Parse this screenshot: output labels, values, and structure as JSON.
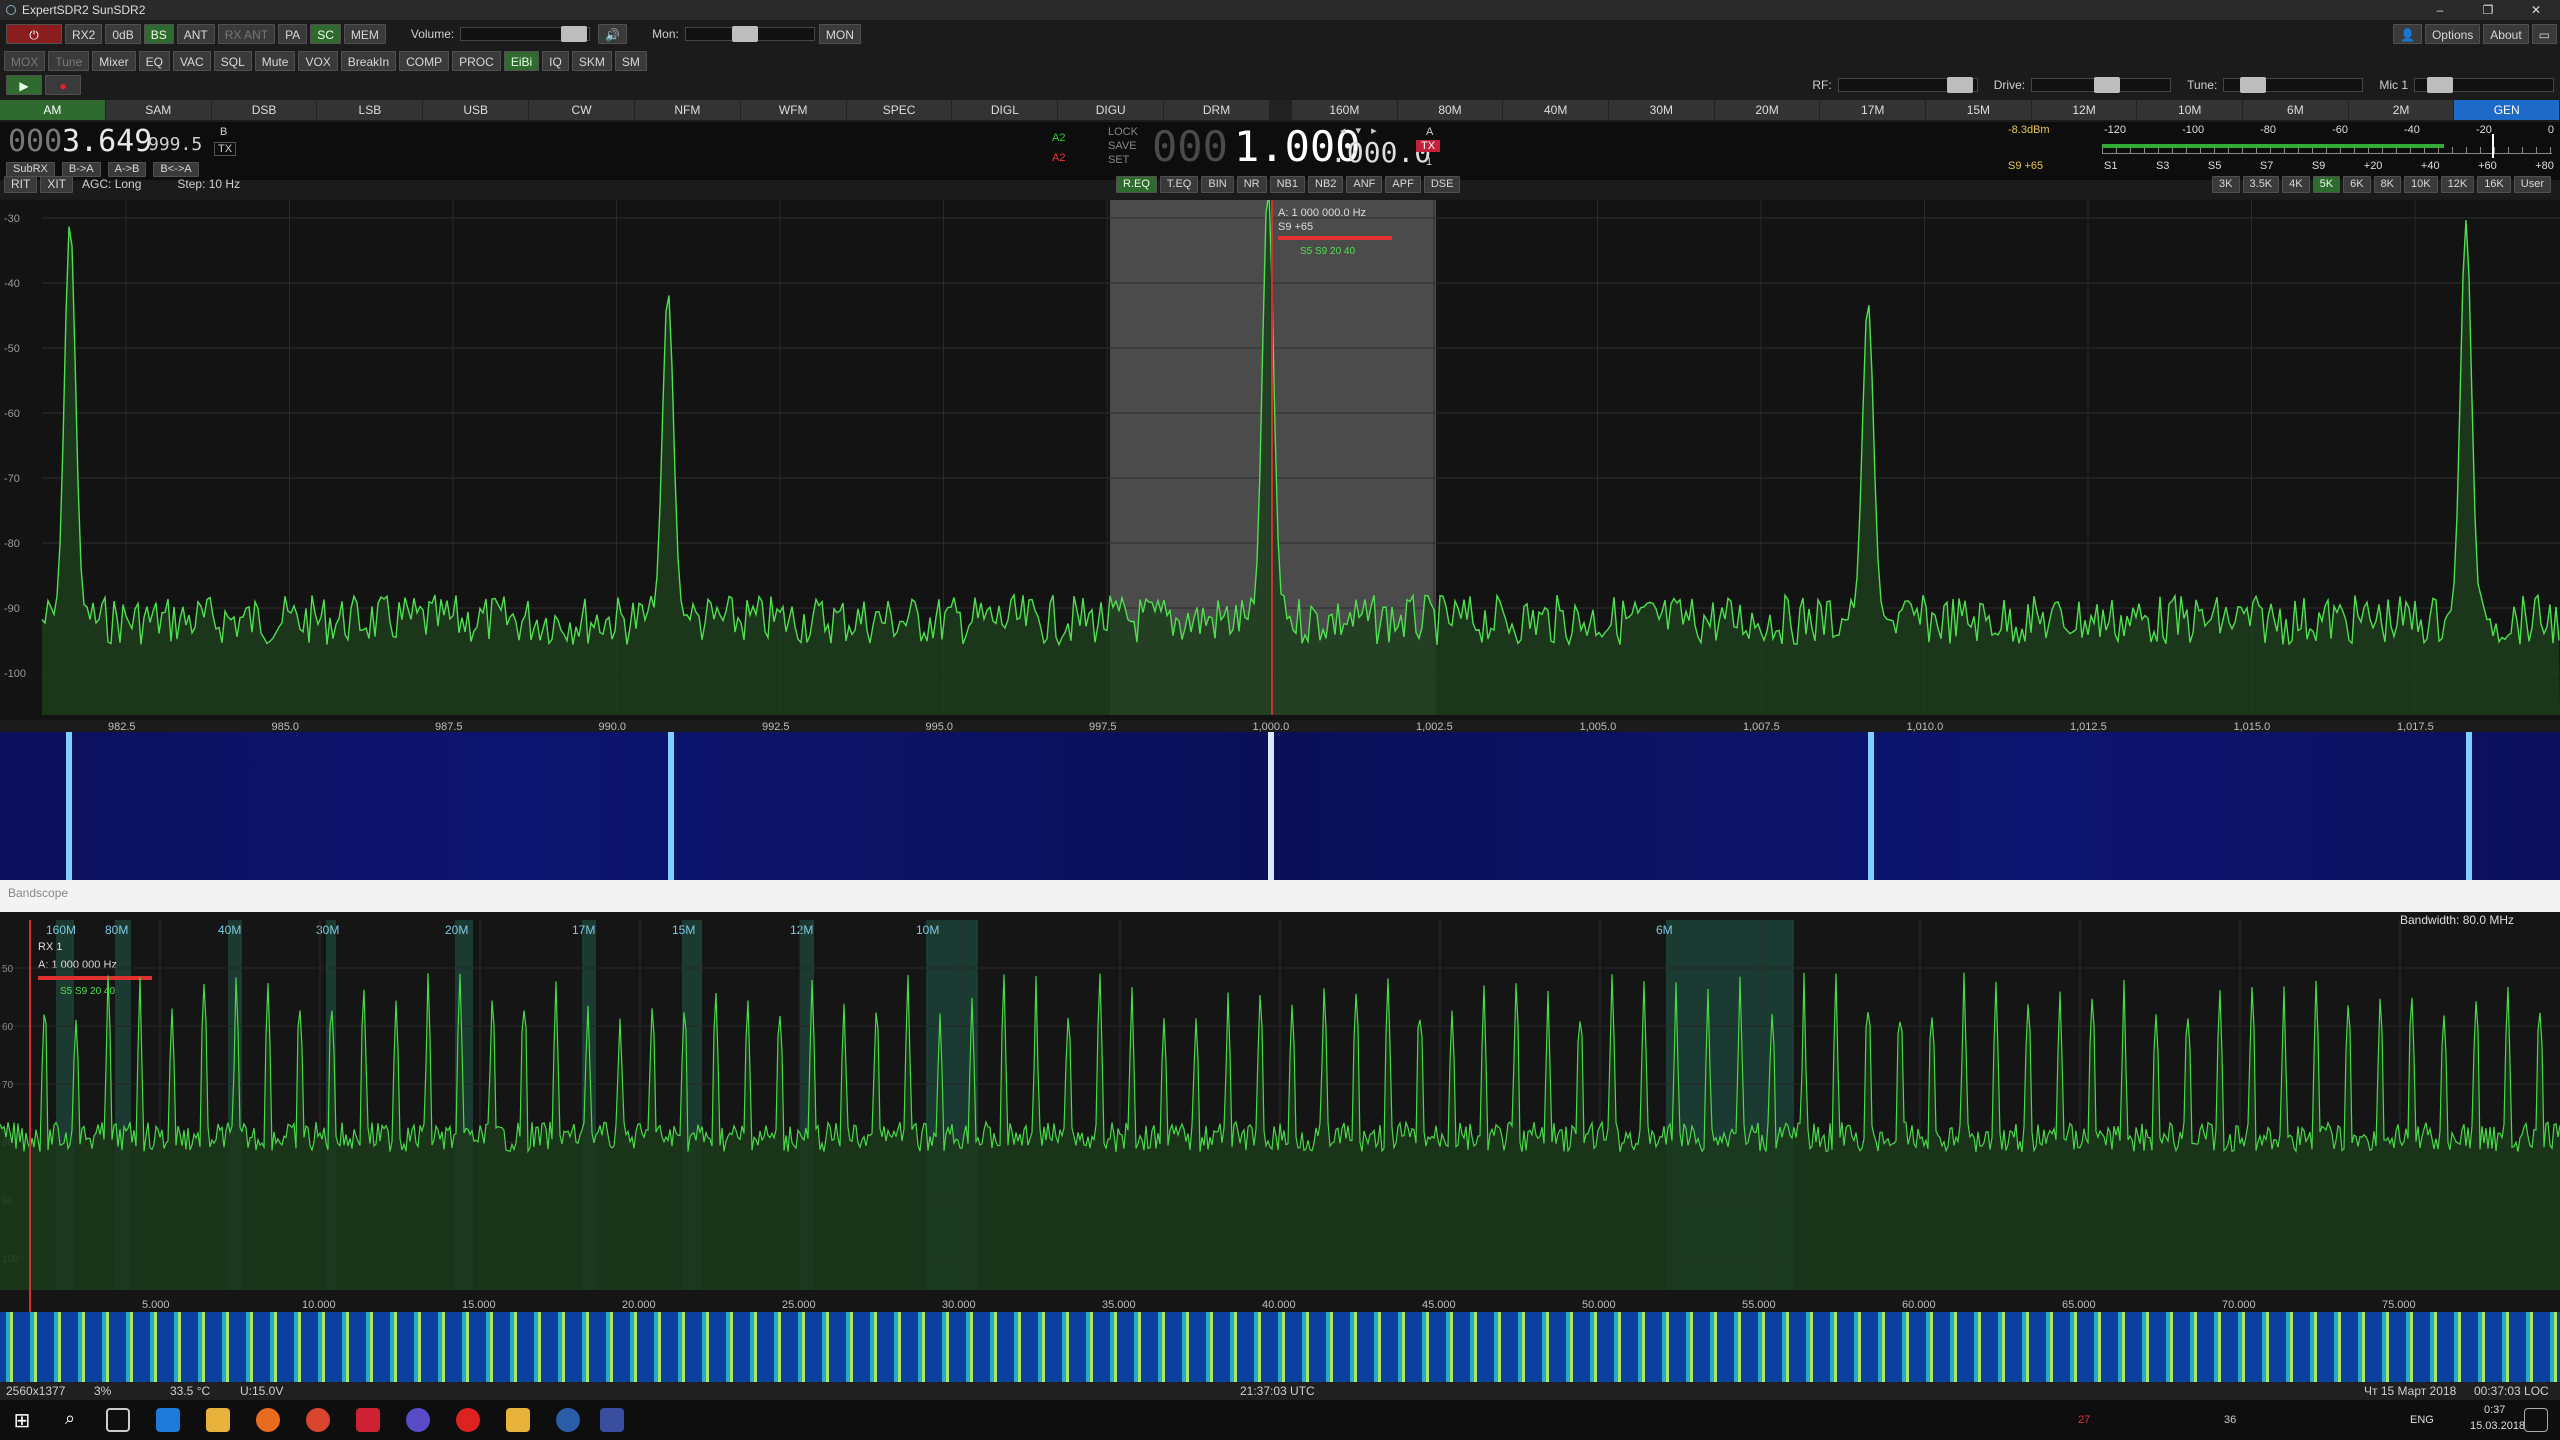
{
  "window": {
    "title": "ExpertSDR2 SunSDR2",
    "minimize": "–",
    "maximize": "❐",
    "close": "✕"
  },
  "toolbar1": {
    "power_icon": "power-icon",
    "rx2": "RX2",
    "att": "0dB",
    "bs": "BS",
    "ant": "ANT",
    "rxant": "RX ANT",
    "pa": "PA",
    "sc": "SC",
    "mem": "MEM",
    "volume_label": "Volume:",
    "mon_label": "Mon:",
    "mon_btn": "MON",
    "options": "Options",
    "about": "About"
  },
  "toolbar2": {
    "items": [
      "MOX",
      "Tune",
      "Mixer",
      "EQ",
      "VAC",
      "SQL",
      "Mute",
      "VOX",
      "BreakIn",
      "COMP",
      "PROC",
      "EiBi",
      "IQ",
      "SKM",
      "SM"
    ]
  },
  "toolbar3": {
    "rf_label": "RF:",
    "drive_label": "Drive:",
    "tune_label": "Tune:",
    "mic_label": "Mic 1"
  },
  "modes": [
    "AM",
    "SAM",
    "DSB",
    "LSB",
    "USB",
    "CW",
    "NFM",
    "WFM",
    "SPEC",
    "DIGL",
    "DIGU",
    "DRM"
  ],
  "bands": [
    "160M",
    "80M",
    "40M",
    "30M",
    "20M",
    "17M",
    "15M",
    "12M",
    "10M",
    "6M",
    "2M",
    "GEN"
  ],
  "vfo_b": {
    "freq_dim": "000",
    "freq_main": "3.649",
    "freq_sub": "999.5",
    "label": "B",
    "tx": "TX",
    "subrx": "SubRX",
    "ab": "B->A",
    "atob": "A->B",
    "swap": "B<->A"
  },
  "vfo_a": {
    "a2": "A2",
    "a2b": "A2",
    "lock": "LOCK",
    "save": "SAVE",
    "set": "SET",
    "freq_dim": "000",
    "freq_main": "1.000",
    "freq_sub": ".000.0",
    "label": "A",
    "tx": "TX",
    "num": "1"
  },
  "smeter": {
    "dbm": "-8.3dBm",
    "reading": "S9 +65",
    "scale_top": [
      "-120",
      "-100",
      "-80",
      "-60",
      "-40",
      "-20",
      "0"
    ],
    "scale_bottom": [
      "S1",
      "S3",
      "S5",
      "S7",
      "S9",
      "+20",
      "+40",
      "+60",
      "+80"
    ]
  },
  "controls_row": {
    "rit": "RIT",
    "xit": "XIT",
    "agc": "AGC: Long",
    "step": "Step: 10 Hz",
    "dsp": [
      "R.EQ",
      "T.EQ",
      "BIN",
      "NR",
      "NB1",
      "NB2",
      "ANF",
      "APF",
      "DSE"
    ],
    "bw": [
      "3K",
      "3.5K",
      "4K",
      "5K",
      "6K",
      "8K",
      "10K",
      "12K",
      "16K",
      "User"
    ]
  },
  "spectrum": {
    "y_ticks": [
      "-30",
      "-40",
      "-50",
      "-60",
      "-70",
      "-80",
      "-90",
      "-100"
    ],
    "x_ticks": [
      "982.5",
      "985.0",
      "987.5",
      "990.0",
      "992.5",
      "995.0",
      "997.5",
      "1,000.0",
      "1,002.5",
      "1,005.0",
      "1,007.5",
      "1,010.0",
      "1,012.5",
      "1,015.0",
      "1,017.5"
    ],
    "marker_freq": "A: 1 000 000.0 Hz",
    "marker_s": "S9 +65",
    "marker_scale": "S5 S9 20 40"
  },
  "bandscope": {
    "title": "Bandscope",
    "bandwidth": "Bandwidth: 80.0 MHz",
    "rx": "RX 1",
    "freq": "A: 1 000 000 Hz",
    "scale": "S5 S9 20 40",
    "bands": [
      "160M",
      "80M",
      "40M",
      "30M",
      "20M",
      "17M",
      "15M",
      "12M",
      "10M",
      "6M"
    ],
    "x_ticks": [
      "5.000",
      "10.000",
      "15.000",
      "20.000",
      "25.000",
      "30.000",
      "35.000",
      "40.000",
      "45.000",
      "50.000",
      "55.000",
      "60.000",
      "65.000",
      "70.000",
      "75.000"
    ],
    "y_ticks": [
      "50",
      "60",
      "70",
      "80",
      "90",
      "100"
    ]
  },
  "status": {
    "resolution": "2560x1377",
    "cpu": "3%",
    "temp": "33.5 °C",
    "voltage": "U:15.0V",
    "utc": "21:37:03 UTC",
    "date_local": "Чт 15 Март 2018",
    "local_time": "00:37:03 LOC"
  },
  "taskbar": {
    "lang": "ENG",
    "time": "0:37",
    "date": "15.03.2018",
    "tray_nums": [
      "27",
      "36"
    ]
  }
}
